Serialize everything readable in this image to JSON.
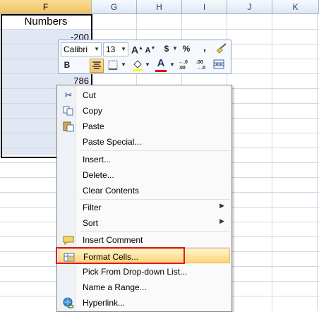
{
  "columns": [
    "F",
    "G",
    "H",
    "I",
    "J",
    "K"
  ],
  "cells": {
    "header": "Numbers",
    "row1": "-200",
    "row4": "786"
  },
  "mini_toolbar": {
    "font_name": "Calibri",
    "font_size": "13",
    "grow_font": "A",
    "shrink_font": "A",
    "currency": "$",
    "percent": "%",
    "comma": ",",
    "bold": "B",
    "font_color_letter": "A",
    "increase_decimal": "←.0 .00",
    "decrease_decimal": ".00 →.0"
  },
  "context_menu": {
    "items": [
      {
        "label": "Cut",
        "icon": "scissors-icon"
      },
      {
        "label": "Copy",
        "icon": "copy-icon"
      },
      {
        "label": "Paste",
        "icon": "paste-icon"
      },
      {
        "label": "Paste Special..."
      },
      {
        "label": "Insert..."
      },
      {
        "label": "Delete..."
      },
      {
        "label": "Clear Contents"
      },
      {
        "label": "Filter",
        "submenu": true
      },
      {
        "label": "Sort",
        "submenu": true
      },
      {
        "label": "Insert Comment",
        "icon": "comment-icon"
      },
      {
        "label": "Format Cells...",
        "icon": "format-cells-icon",
        "highlighted": true
      },
      {
        "label": "Pick From Drop-down List..."
      },
      {
        "label": "Name a Range..."
      },
      {
        "label": "Hyperlink...",
        "icon": "hyperlink-icon"
      }
    ]
  },
  "colors": {
    "highlight_border": "#e0191f",
    "menu_hover": "#fcd57a",
    "selection_fill": "#e1e8f4"
  }
}
